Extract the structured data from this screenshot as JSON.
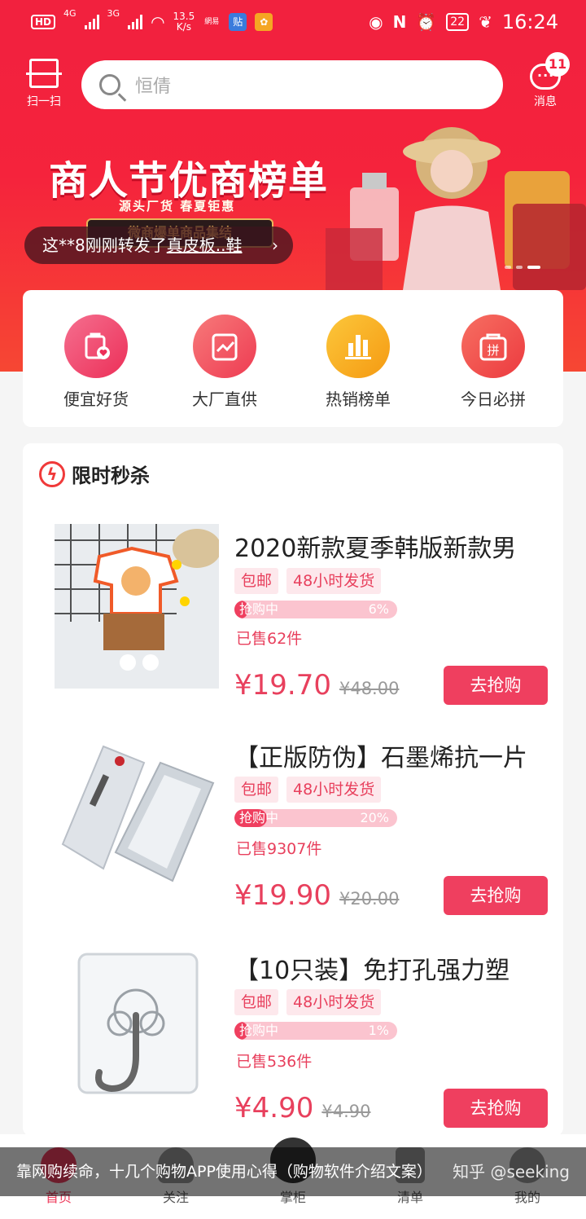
{
  "status_bar": {
    "hd": "HD",
    "net1": "4G",
    "net2": "3G",
    "speed": "13.5",
    "speed_unit": "K/s",
    "app1": "網易",
    "app2": "贴",
    "battery": "22",
    "time": "16:24"
  },
  "header": {
    "scan_label": "扫一扫",
    "search_placeholder": "恒倩",
    "messages_label": "消息",
    "messages_count": "11"
  },
  "banner": {
    "title": "商人节优商榜单",
    "subtitle": "源头厂货  春夏钜惠",
    "tag": "微商爆单商品集结",
    "ticker_prefix": "这**8刚刚转发了",
    "ticker_link": "真皮板..鞋",
    "ticker_arrow": "›"
  },
  "categories": [
    {
      "label": "便宜好货",
      "icon": "bag-heart-icon",
      "color": "#f0446a"
    },
    {
      "label": "大厂直供",
      "icon": "chart-clipboard-icon",
      "color": "#f04b5c"
    },
    {
      "label": "热销榜单",
      "icon": "bar-chart-icon",
      "color": "#f7a21b"
    },
    {
      "label": "今日必拼",
      "icon": "pin-bag-icon",
      "color": "#f04b4b"
    }
  ],
  "flash_sale": {
    "title": "限时秒杀",
    "bar_label": "抢购中",
    "buy_label": "去抢购",
    "products": [
      {
        "title": "2020新款夏季韩版新款男",
        "tags": [
          "包邮",
          "48小时发货"
        ],
        "progress": "6%",
        "progress_value": 0.06,
        "sold": "已售62件",
        "price": "¥19.70",
        "old_price": "¥48.00",
        "image": "kids-clothing"
      },
      {
        "title": "【正版防伪】石墨烯抗一片",
        "tags": [
          "包邮",
          "48小时发货"
        ],
        "progress": "20%",
        "progress_value": 0.2,
        "sold": "已售9307件",
        "price": "¥19.90",
        "old_price": "¥20.00",
        "image": "mask-box"
      },
      {
        "title": "【10只装】免打孔强力塑",
        "tags": [
          "包邮",
          "48小时发货"
        ],
        "progress": "1%",
        "progress_value": 0.01,
        "sold": "已售536件",
        "price": "¥4.90",
        "old_price": "¥4.90",
        "image": "wall-hook"
      }
    ]
  },
  "bottom_nav": [
    {
      "label": "首页",
      "icon": "home-icon"
    },
    {
      "label": "关注",
      "icon": "heart-icon"
    },
    {
      "label": "掌柜",
      "icon": "shopkeeper-icon"
    },
    {
      "label": "清单",
      "icon": "list-icon"
    },
    {
      "label": "我的",
      "icon": "profile-icon"
    }
  ],
  "overlay": {
    "caption": "靠网购续命，十几个购物APP使用心得（购物软件介绍文案）",
    "watermark": "知乎 @seeking"
  },
  "colors": {
    "brand_red": "#f2213e",
    "accent_pink": "#e8405d",
    "button": "#ef3f5f"
  }
}
